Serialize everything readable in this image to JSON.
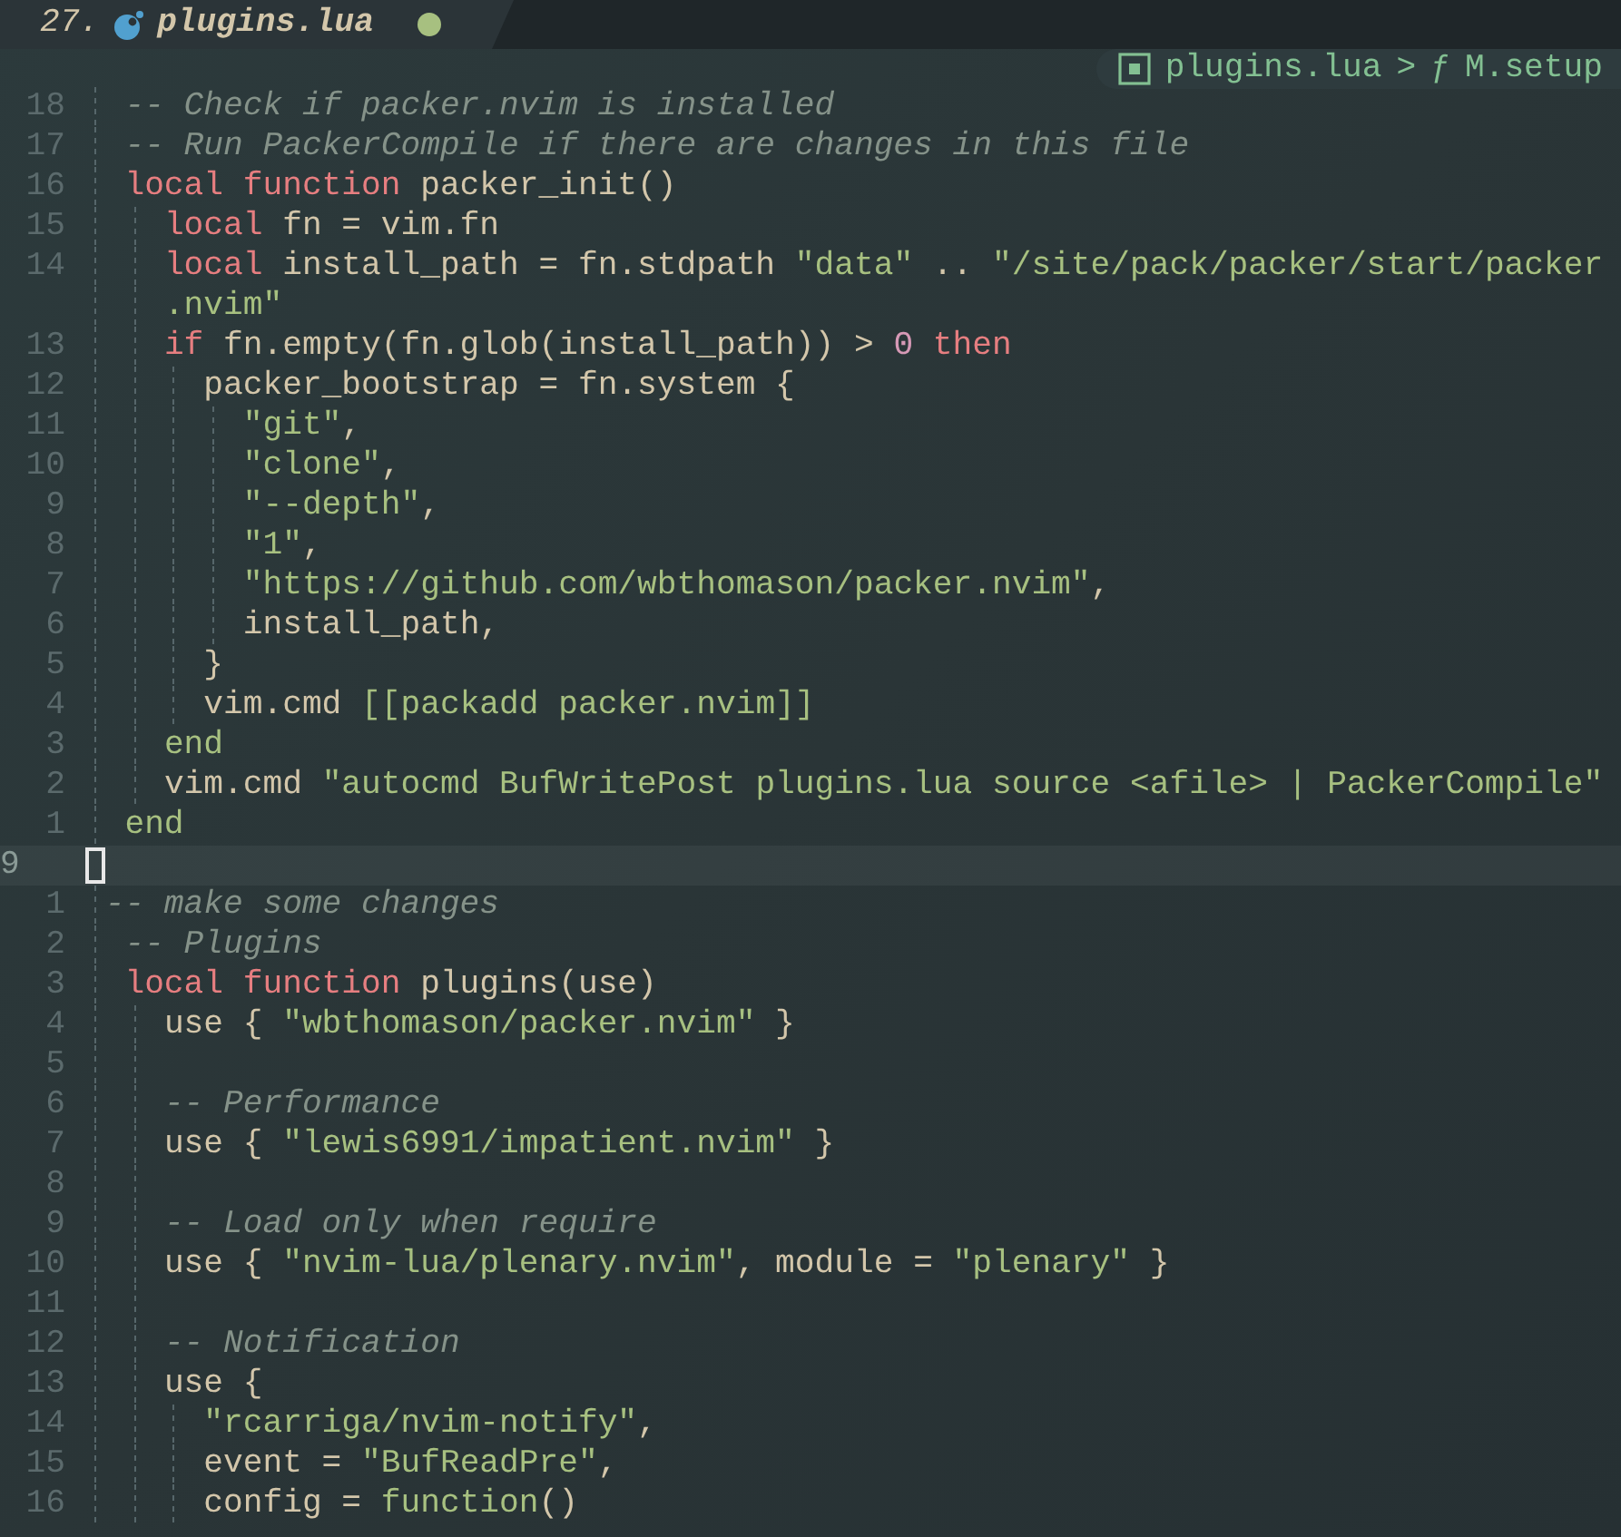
{
  "tab": {
    "number": "27.",
    "title": "plugins.lua",
    "modified": true
  },
  "breadcrumb": {
    "file": "plugins.lua",
    "separator": ">",
    "symbol_glyph": "ƒ",
    "symbol": "M.setup"
  },
  "lines": [
    {
      "number": "18",
      "current": false,
      "code": [
        {
          "kind": "comment",
          "text": "  -- Check if packer.nvim is installed"
        }
      ]
    },
    {
      "number": "17",
      "current": false,
      "code": [
        {
          "kind": "comment",
          "text": "  -- Run PackerCompile if there are changes in this file"
        }
      ]
    },
    {
      "number": "16",
      "current": false,
      "code": [
        {
          "kind": "keyword",
          "text": "  local function"
        },
        {
          "kind": "plain",
          "text": " packer_init()"
        }
      ]
    },
    {
      "number": "15",
      "current": false,
      "code": [
        {
          "kind": "keyword",
          "text": "    local"
        },
        {
          "kind": "plain",
          "text": " fn = vim.fn"
        }
      ]
    },
    {
      "number": "14",
      "current": false,
      "code": [
        {
          "kind": "keyword",
          "text": "    local"
        },
        {
          "kind": "plain",
          "text": " install_path = fn.stdpath "
        },
        {
          "kind": "string",
          "text": "\"data\""
        },
        {
          "kind": "plain",
          "text": " .. "
        },
        {
          "kind": "string",
          "text": "\"/site/pack/packer/start/packer"
        }
      ]
    },
    {
      "current": false,
      "code": [
        {
          "kind": "string",
          "text": "    .nvim\""
        }
      ]
    },
    {
      "number": "13",
      "current": false,
      "code": [
        {
          "kind": "keyword",
          "text": "    if"
        },
        {
          "kind": "plain",
          "text": " fn.empty(fn.glob(install_path)) > "
        },
        {
          "kind": "number",
          "text": "0"
        },
        {
          "kind": "keyword",
          "text": " then"
        }
      ]
    },
    {
      "number": "12",
      "current": false,
      "code": [
        {
          "kind": "plain",
          "text": "      packer_bootstrap = fn.system {"
        }
      ]
    },
    {
      "number": "11",
      "current": false,
      "code": [
        {
          "kind": "string",
          "text": "        \"git\""
        },
        {
          "kind": "plain",
          "text": ","
        }
      ]
    },
    {
      "number": "10",
      "current": false,
      "code": [
        {
          "kind": "string",
          "text": "        \"clone\""
        },
        {
          "kind": "plain",
          "text": ","
        }
      ]
    },
    {
      "number": "9",
      "current": false,
      "code": [
        {
          "kind": "string",
          "text": "        \"--depth\""
        },
        {
          "kind": "plain",
          "text": ","
        }
      ]
    },
    {
      "number": "8",
      "current": false,
      "code": [
        {
          "kind": "string",
          "text": "        \"1\""
        },
        {
          "kind": "plain",
          "text": ","
        }
      ]
    },
    {
      "number": "7",
      "current": false,
      "code": [
        {
          "kind": "string",
          "text": "        \"https://github.com/wbthomason/packer.nvim\""
        },
        {
          "kind": "plain",
          "text": ","
        }
      ]
    },
    {
      "number": "6",
      "current": false,
      "code": [
        {
          "kind": "plain",
          "text": "        install_path,"
        }
      ]
    },
    {
      "number": "5",
      "current": false,
      "code": [
        {
          "kind": "plain",
          "text": "      }"
        }
      ]
    },
    {
      "number": "4",
      "current": false,
      "code": [
        {
          "kind": "plain",
          "text": "      vim.cmd "
        },
        {
          "kind": "string",
          "text": "[[packadd packer.nvim]]"
        }
      ]
    },
    {
      "number": "3",
      "current": false,
      "code": [
        {
          "kind": "keyword-alt",
          "text": "    end"
        }
      ]
    },
    {
      "number": "2",
      "current": false,
      "code": [
        {
          "kind": "plain",
          "text": "    vim.cmd "
        },
        {
          "kind": "string",
          "text": "\"autocmd BufWritePost plugins.lua source <afile> | PackerCompile\""
        }
      ]
    },
    {
      "number": "1",
      "current": false,
      "code": [
        {
          "kind": "keyword-alt",
          "text": "  end"
        }
      ]
    },
    {
      "number": "9",
      "current": true
    },
    {
      "number": "1",
      "current": false,
      "code": [
        {
          "kind": "comment",
          "text": " -- make some changes"
        }
      ]
    },
    {
      "number": "2",
      "current": false,
      "code": [
        {
          "kind": "comment",
          "text": "  -- Plugins"
        }
      ]
    },
    {
      "number": "3",
      "current": false,
      "code": [
        {
          "kind": "keyword",
          "text": "  local function"
        },
        {
          "kind": "plain",
          "text": " plugins(use)"
        }
      ]
    },
    {
      "number": "4",
      "current": false,
      "code": [
        {
          "kind": "plain",
          "text": "    use { "
        },
        {
          "kind": "string",
          "text": "\"wbthomason/packer.nvim\""
        },
        {
          "kind": "plain",
          "text": " }"
        }
      ]
    },
    {
      "number": "5",
      "current": false
    },
    {
      "number": "6",
      "current": false,
      "code": [
        {
          "kind": "comment",
          "text": "    -- Performance"
        }
      ]
    },
    {
      "number": "7",
      "current": false,
      "code": [
        {
          "kind": "plain",
          "text": "    use { "
        },
        {
          "kind": "string",
          "text": "\"lewis6991/impatient.nvim\""
        },
        {
          "kind": "plain",
          "text": " }"
        }
      ]
    },
    {
      "number": "8",
      "current": false
    },
    {
      "number": "9",
      "current": false,
      "code": [
        {
          "kind": "comment",
          "text": "    -- Load only when require"
        }
      ]
    },
    {
      "number": "10",
      "current": false,
      "code": [
        {
          "kind": "plain",
          "text": "    use { "
        },
        {
          "kind": "string",
          "text": "\"nvim-lua/plenary.nvim\""
        },
        {
          "kind": "plain",
          "text": ", module = "
        },
        {
          "kind": "string",
          "text": "\"plenary\""
        },
        {
          "kind": "plain",
          "text": " }"
        }
      ]
    },
    {
      "number": "11",
      "current": false
    },
    {
      "number": "12",
      "current": false,
      "code": [
        {
          "kind": "comment",
          "text": "    -- Notification"
        }
      ]
    },
    {
      "number": "13",
      "current": false,
      "code": [
        {
          "kind": "plain",
          "text": "    use {"
        }
      ]
    },
    {
      "number": "14",
      "current": false,
      "code": [
        {
          "kind": "string",
          "text": "      \"rcarriga/nvim-notify\""
        },
        {
          "kind": "plain",
          "text": ","
        }
      ]
    },
    {
      "number": "15",
      "current": false,
      "code": [
        {
          "kind": "plain",
          "text": "      event = "
        },
        {
          "kind": "string",
          "text": "\"BufReadPre\""
        },
        {
          "kind": "plain",
          "text": ","
        }
      ]
    },
    {
      "number": "16",
      "current": false,
      "code": [
        {
          "kind": "plain",
          "text": "      config = "
        },
        {
          "kind": "keyword-alt",
          "text": "function"
        },
        {
          "kind": "plain",
          "text": "()"
        }
      ]
    }
  ]
}
